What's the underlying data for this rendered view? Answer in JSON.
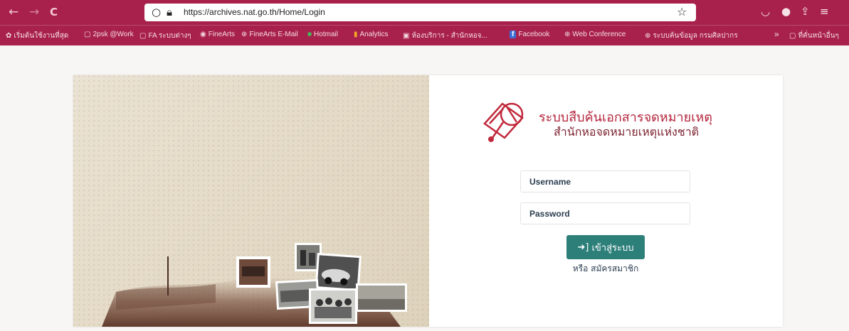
{
  "browser": {
    "url": "https://archives.nat.go.th/Home/Login",
    "nav": {
      "back": "←",
      "forward": "→",
      "reload": "C"
    },
    "bookmarks": [
      {
        "icon": "✿",
        "label": "เริ่มต้นใช้งานที่สุด"
      },
      {
        "icon": "▢",
        "label": "2psk @Work"
      },
      {
        "icon": "▢",
        "label": "FA ระบบต่างๆ"
      },
      {
        "icon": "◉",
        "label": "FineArts"
      },
      {
        "icon": "⊕",
        "label": "FineArts E-Mail"
      },
      {
        "icon": "■",
        "label": "Hotmail"
      },
      {
        "icon": "▮",
        "label": "Analytics"
      },
      {
        "icon": "▣",
        "label": "ห้องบริการ - สำนักหอจ..."
      },
      {
        "icon": "f",
        "label": "Facebook"
      },
      {
        "icon": "⊕",
        "label": "Web Conference"
      },
      {
        "icon": "⊕",
        "label": "ระบบค้นข้อมูล กรมศิลปากร"
      }
    ],
    "overflow": "»",
    "other_bookmarks": "ที่คั่นหน้าอื่นๆ"
  },
  "login": {
    "title_line1": "ระบบสืบค้นเอกสารจดหมายเหตุ",
    "title_line2": "สำนักหอจดหมายเหตุแห่งชาติ",
    "username_placeholder": "Username",
    "password_placeholder": "Password",
    "submit_label": "เข้าสู่ระบบ",
    "register_label": "หรือ สมัครสมาชิก"
  },
  "colors": {
    "browser_accent": "#a8214c",
    "button": "#2d7f7a",
    "title": "#b3263d"
  }
}
